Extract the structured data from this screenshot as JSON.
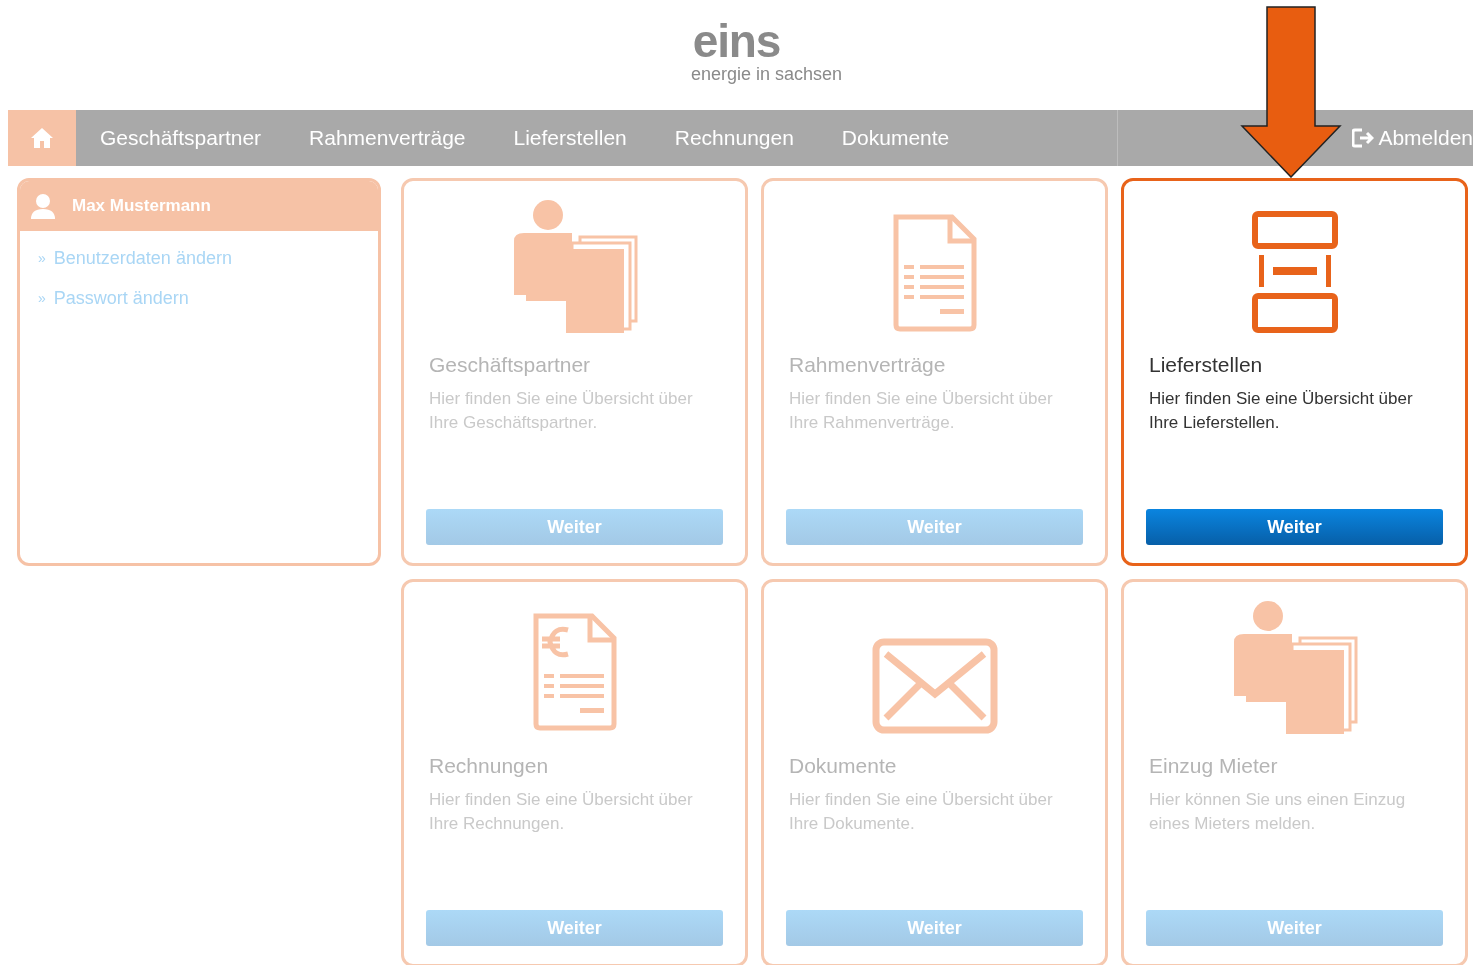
{
  "logo": {
    "name": "eins",
    "tagline": "energie in sachsen"
  },
  "nav": {
    "items": [
      {
        "label": "Geschäftspartner"
      },
      {
        "label": "Rahmenverträge"
      },
      {
        "label": "Lieferstellen"
      },
      {
        "label": "Rechnungen"
      },
      {
        "label": "Dokumente"
      }
    ],
    "logout": "Abmelden"
  },
  "user_panel": {
    "name": "Max Mustermann",
    "links": [
      {
        "marker": "»",
        "label": "Benutzerdaten ändern"
      },
      {
        "marker": "»",
        "label": "Passwort ändern"
      }
    ]
  },
  "cards": [
    {
      "kind": "partner",
      "title": "Geschäftspartner",
      "text": "Hier finden Sie eine Übersicht über Ihre Geschäftspartner.",
      "button": "Weiter",
      "highlighted": false
    },
    {
      "kind": "contract",
      "title": "Rahmenverträge",
      "text": "Hier finden Sie eine Übersicht über Ihre Rahmenverträge.",
      "button": "Weiter",
      "highlighted": false
    },
    {
      "kind": "meter",
      "title": "Lieferstellen",
      "text": "Hier finden Sie eine Übersicht über Ihre Lieferstellen.",
      "button": "Weiter",
      "highlighted": true
    },
    {
      "kind": "invoice",
      "title": "Rechnungen",
      "text": "Hier finden Sie eine Übersicht über Ihre Rechnungen.",
      "button": "Weiter",
      "highlighted": false
    },
    {
      "kind": "mail",
      "title": "Dokumente",
      "text": "Hier finden Sie eine Übersicht über Ihre Dokumente.",
      "button": "Weiter",
      "highlighted": false
    },
    {
      "kind": "partner",
      "title": "Einzug Mieter",
      "text": "Hier können Sie uns einen Einzug eines Mieters melden.",
      "button": "Weiter",
      "highlighted": false
    }
  ]
}
